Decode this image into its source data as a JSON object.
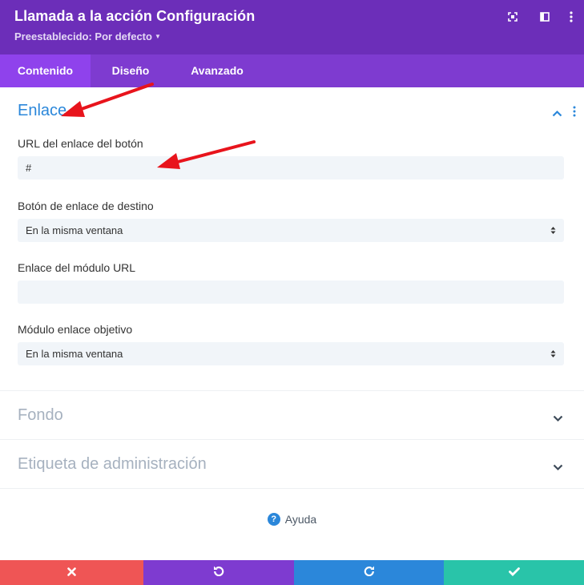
{
  "header": {
    "title": "Llamada a la acción Configuración",
    "preset_label": "Preestablecido: Por defecto",
    "icons": [
      "expand-icon",
      "sidebar-icon",
      "more-icon"
    ]
  },
  "tabs": [
    {
      "label": "Contenido",
      "active": true
    },
    {
      "label": "Diseño",
      "active": false
    },
    {
      "label": "Avanzado",
      "active": false
    }
  ],
  "sections": {
    "enlace": {
      "title": "Enlace",
      "expanded": true,
      "fields": {
        "url_label": "URL del enlace del botón",
        "url_value": "#",
        "target_label": "Botón de enlace de destino",
        "target_value": "En la misma ventana",
        "module_url_label": "Enlace del módulo URL",
        "module_url_value": "",
        "module_target_label": "Módulo enlace objetivo",
        "module_target_value": "En la misma ventana"
      }
    },
    "fondo": {
      "title": "Fondo",
      "expanded": false
    },
    "admin": {
      "title": "Etiqueta de administración",
      "expanded": false
    }
  },
  "help": {
    "label": "Ayuda",
    "icon": "question-icon"
  },
  "footer": {
    "buttons": [
      {
        "name": "cancel",
        "icon": "close-icon",
        "color": "#ef5555"
      },
      {
        "name": "undo",
        "icon": "undo-icon",
        "color": "#7e3bd0"
      },
      {
        "name": "redo",
        "icon": "redo-icon",
        "color": "#2b87da"
      },
      {
        "name": "save",
        "icon": "check-icon",
        "color": "#29c4a9"
      }
    ]
  },
  "colors": {
    "header_bg": "#6c2eb9",
    "tabs_bg": "#7e3bd0",
    "active_tab_bg": "#8f42ec",
    "accent_blue": "#2b87da",
    "annotation_arrow": "#e8141c"
  }
}
